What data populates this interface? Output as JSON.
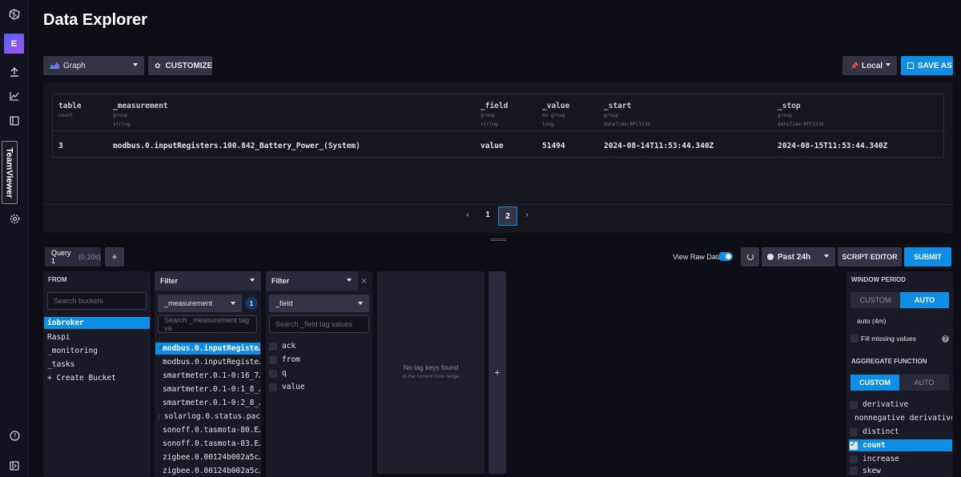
{
  "sidebar": {
    "logo": "influx-logo-icon",
    "active_item": "E",
    "teamviewer_label": "TeamViewer"
  },
  "page_title": "Data Explorer",
  "toolbar": {
    "graph_label": "Graph",
    "customize_label": "CUSTOMIZE",
    "timezone_label": "Local",
    "save_as_label": "SAVE AS"
  },
  "raw_table": {
    "columns": [
      {
        "name": "table",
        "sub1": "count",
        "sub2": ""
      },
      {
        "name": "_measurement",
        "sub1": "group",
        "sub2": "string"
      },
      {
        "name": "_field",
        "sub1": "group",
        "sub2": "string"
      },
      {
        "name": "_value",
        "sub1": "no group",
        "sub2": "long"
      },
      {
        "name": "_start",
        "sub1": "group",
        "sub2": "dateTime:RFC3339"
      },
      {
        "name": "_stop",
        "sub1": "group",
        "sub2": "dateTime:RFC3339"
      }
    ],
    "row": [
      "3",
      "modbus.0.inputRegisters.100.842_Battery_Power_(System)",
      "value",
      "51494",
      "2024-08-14T11:53:44.340Z",
      "2024-08-15T11:53:44.340Z"
    ]
  },
  "pagination": {
    "prev": "‹",
    "pages": [
      "1",
      "2"
    ],
    "next": "›"
  },
  "query": {
    "tab_label": "Query 1",
    "tab_time": "(0.10s)",
    "add_label": "+",
    "view_raw_label": "View Raw Data",
    "time_range_label": "Past 24h",
    "script_editor_label": "SCRIPT EDITOR",
    "submit_label": "SUBMIT"
  },
  "from": {
    "title": "FROM",
    "search_placeholder": "Search buckets",
    "buckets": [
      "iobroker",
      "Raspi",
      "_monitoring",
      "_tasks",
      "+ Create Bucket"
    ]
  },
  "filter1": {
    "title": "Filter",
    "key": "_measurement",
    "badge": "1",
    "search_placeholder": "Search _measurement tag va",
    "values": [
      "modbus.0.inputRegiste…",
      "modbus.0.inputRegiste…",
      "smartmeter.0.1-0:16_7…",
      "smartmeter.0.1-0:1_8_…",
      "smartmeter.0.1-0:2_8_…",
      "solarlog.0.status.pac",
      "sonoff.0.tasmota-80.E…",
      "sonoff.0.tasmota-83.E…",
      "zigbee.0.00124b002a5c…",
      "zigbee.0.00124b002a5c…"
    ]
  },
  "filter2": {
    "title": "Filter",
    "key": "_field",
    "search_placeholder": "Search _field tag values",
    "values": [
      "ack",
      "from",
      "q",
      "value"
    ]
  },
  "filter3": {
    "empty_title": "No tag keys found",
    "empty_sub": "in the current time range"
  },
  "window": {
    "title": "WINDOW PERIOD",
    "custom": "CUSTOM",
    "auto": "AUTO",
    "period_value": "auto (4m)",
    "fill_missing": "Fill missing values",
    "help": "?"
  },
  "aggregate": {
    "title": "AGGREGATE FUNCTION",
    "custom": "CUSTOM",
    "auto": "AUTO",
    "functions": [
      "derivative",
      "nonnegative derivative",
      "distinct",
      "count",
      "increase",
      "skew"
    ]
  }
}
